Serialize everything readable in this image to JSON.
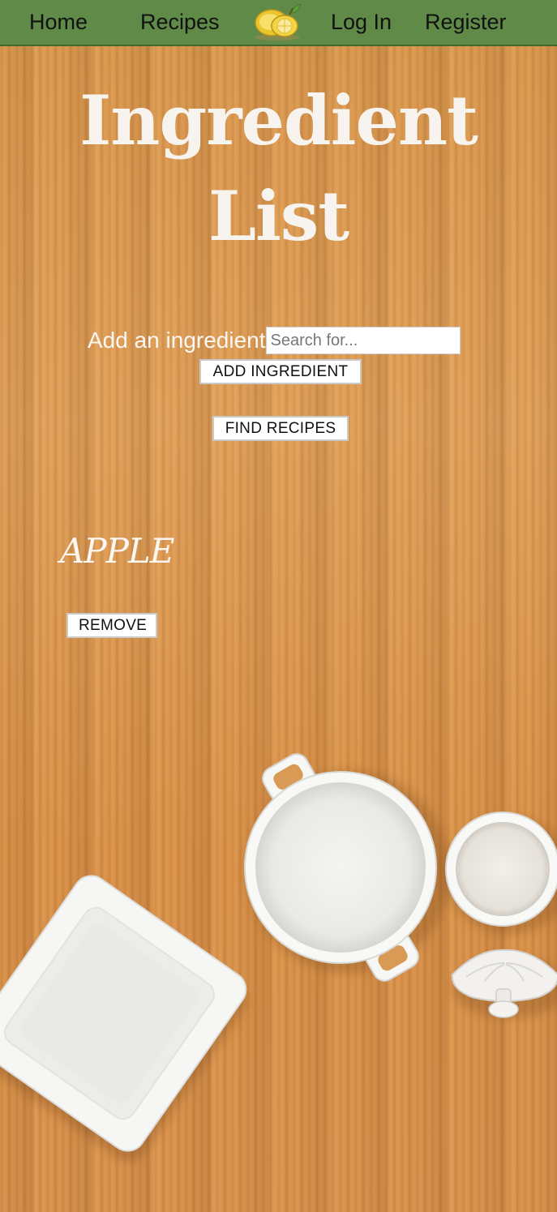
{
  "nav": {
    "items": [
      {
        "label": "Home"
      },
      {
        "label": "Recipes"
      },
      {
        "label": "Log In"
      },
      {
        "label": "Register"
      }
    ],
    "logo_icon": "lemon-logo-icon"
  },
  "page": {
    "title": "Ingredient List",
    "title_lines": [
      "Ingredient",
      "List"
    ]
  },
  "add_form": {
    "label": "Add an ingredient",
    "search_placeholder": "Search for...",
    "search_value": "",
    "add_button": "ADD INGREDIENT",
    "find_button": "FIND RECIPES"
  },
  "ingredients": [
    {
      "name": "APPLE",
      "remove_label": "REMOVE"
    }
  ],
  "colors": {
    "nav_bg": "#5f8a47",
    "wood": "#d9974a",
    "title_text": "#f7f3ee"
  }
}
